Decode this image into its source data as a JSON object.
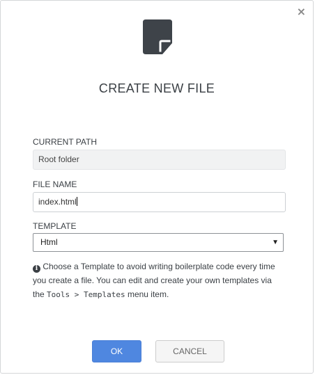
{
  "dialog": {
    "close_glyph": "×",
    "title": "CREATE NEW FILE",
    "file_icon": "file-icon"
  },
  "current_path": {
    "label": "CURRENT PATH",
    "value": "Root folder"
  },
  "file_name": {
    "label": "FILE NAME",
    "value": "index.html"
  },
  "template": {
    "label": "TEMPLATE",
    "selected": "Html"
  },
  "info": {
    "icon": "info-icon",
    "text_before": "Choose a Template to avoid writing boilerplate code every time you create a file. You can edit and create your own templates via the ",
    "menu_tools": "Tools",
    "menu_separator": " > ",
    "menu_templates": "Templates",
    "text_after": " menu item."
  },
  "buttons": {
    "ok": "OK",
    "cancel": "CANCEL"
  },
  "colors": {
    "accent": "#4f87e0",
    "icon_dark": "#3e4349",
    "text": "#3a3f44"
  }
}
